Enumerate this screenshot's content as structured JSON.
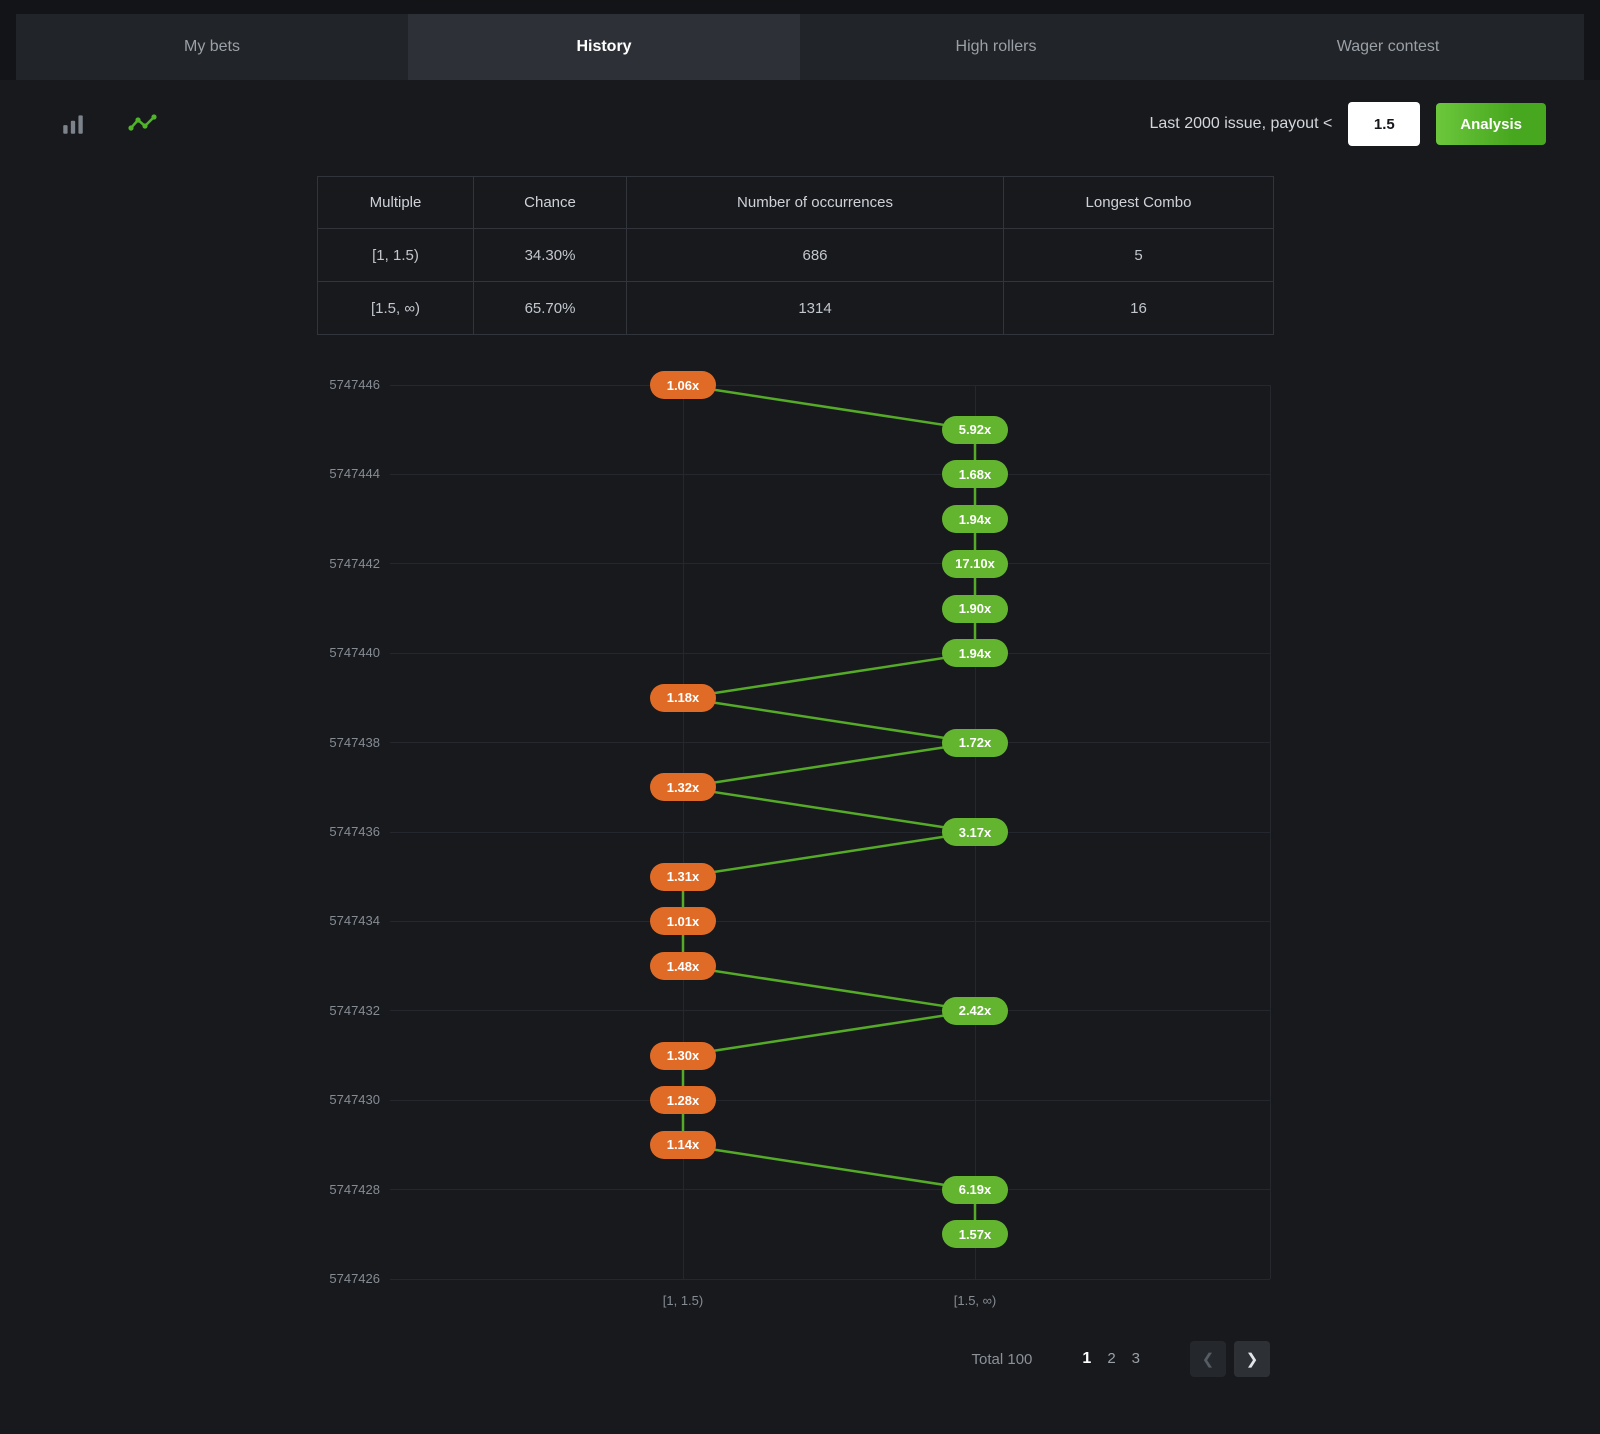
{
  "tabs": [
    {
      "label": "My bets",
      "active": false
    },
    {
      "label": "History",
      "active": true
    },
    {
      "label": "High rollers",
      "active": false
    },
    {
      "label": "Wager contest",
      "active": false
    }
  ],
  "toolbar": {
    "filter_label": "Last 2000 issue, payout <",
    "filter_value": "1.5",
    "analysis_label": "Analysis",
    "icons": [
      "bar-chart-icon",
      "trend-chart-icon"
    ],
    "trend_icon_color": "#4db527",
    "bar_icon_color": "#7c838b"
  },
  "table": {
    "headers": [
      "Multiple",
      "Chance",
      "Number of occurrences",
      "Longest Combo"
    ],
    "rows": [
      [
        "[1, 1.5)",
        "34.30%",
        "686",
        "5"
      ],
      [
        "[1.5, ∞)",
        "65.70%",
        "1314",
        "16"
      ]
    ]
  },
  "chart_data": {
    "type": "line",
    "x_categories": [
      "[1, 1.5)",
      "[1.5, ∞)"
    ],
    "threshold": 1.5,
    "issue_max": 5747446,
    "y_ticks": [
      5747446,
      5747444,
      5747442,
      5747440,
      5747438,
      5747436,
      5747434,
      5747432,
      5747430,
      5747428,
      5747426
    ],
    "colors": {
      "low": "#e06b27",
      "high": "#63b52f",
      "line": "#55aa28"
    },
    "points": [
      {
        "issue": 5747446,
        "label": "1.06x",
        "value": 1.06
      },
      {
        "issue": 5747445,
        "label": "5.92x",
        "value": 5.92
      },
      {
        "issue": 5747444,
        "label": "1.68x",
        "value": 1.68
      },
      {
        "issue": 5747443,
        "label": "1.94x",
        "value": 1.94
      },
      {
        "issue": 5747442,
        "label": "17.10x",
        "value": 17.1
      },
      {
        "issue": 5747441,
        "label": "1.90x",
        "value": 1.9
      },
      {
        "issue": 5747440,
        "label": "1.94x",
        "value": 1.94
      },
      {
        "issue": 5747439,
        "label": "1.18x",
        "value": 1.18
      },
      {
        "issue": 5747438,
        "label": "1.72x",
        "value": 1.72
      },
      {
        "issue": 5747437,
        "label": "1.32x",
        "value": 1.32
      },
      {
        "issue": 5747436,
        "label": "3.17x",
        "value": 3.17
      },
      {
        "issue": 5747435,
        "label": "1.31x",
        "value": 1.31
      },
      {
        "issue": 5747434,
        "label": "1.01x",
        "value": 1.01
      },
      {
        "issue": 5747433,
        "label": "1.48x",
        "value": 1.48
      },
      {
        "issue": 5747432,
        "label": "2.42x",
        "value": 2.42
      },
      {
        "issue": 5747431,
        "label": "1.30x",
        "value": 1.3
      },
      {
        "issue": 5747430,
        "label": "1.28x",
        "value": 1.28
      },
      {
        "issue": 5747429,
        "label": "1.14x",
        "value": 1.14
      },
      {
        "issue": 5747428,
        "label": "6.19x",
        "value": 6.19
      },
      {
        "issue": 5747427,
        "label": "1.57x",
        "value": 1.57
      }
    ]
  },
  "pagination": {
    "total_label": "Total 100",
    "pages": [
      "1",
      "2",
      "3"
    ],
    "active_page": "1",
    "prev_icon": "❮",
    "next_icon": "❯"
  }
}
